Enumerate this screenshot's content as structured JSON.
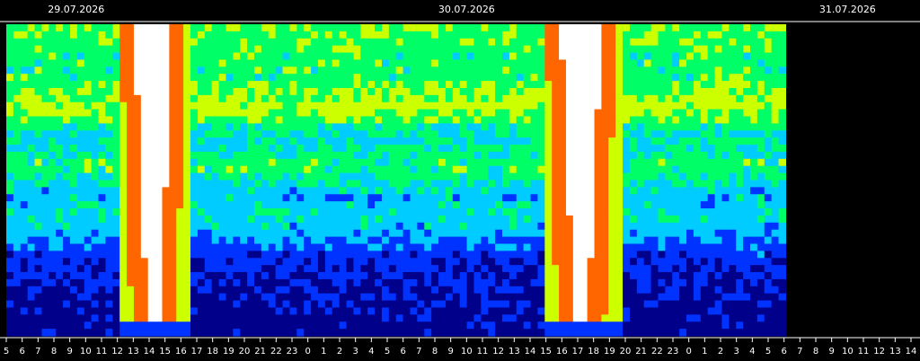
{
  "chart_data": {
    "type": "heatmap",
    "title": "",
    "xlabel": "",
    "ylabel": "",
    "dates": [
      "29.07.2026",
      "30.07.2026",
      "31.07.2026"
    ],
    "hour_ticks": [
      5,
      6,
      7,
      8,
      9,
      10,
      11,
      12,
      13,
      14,
      15,
      16,
      17,
      18,
      19,
      20,
      21,
      22,
      23,
      0,
      1,
      2,
      3,
      4,
      5,
      6,
      7,
      8,
      9,
      10,
      11,
      12,
      13,
      14,
      15,
      16,
      17,
      18,
      19,
      20,
      21,
      22,
      23,
      0,
      1,
      2,
      3,
      4,
      5,
      6,
      7,
      8,
      9,
      10,
      11,
      12,
      13,
      14
    ],
    "data_end_hour_index": 49.1,
    "intensity_bands": [
      {
        "center": 0.25,
        "strength": 0.55
      },
      {
        "center": 0.45,
        "strength": 0.5
      },
      {
        "center": 0.62,
        "strength": 0.4
      }
    ],
    "saturation_events": [
      {
        "start_hour_index": 6.8,
        "end_hour_index": 11.3
      },
      {
        "start_hour_index": 33.6,
        "end_hour_index": 38.4
      }
    ],
    "colormap": [
      "#00008b",
      "#0033ff",
      "#00ccff",
      "#00ff66",
      "#ccff00",
      "#ff6600",
      "#ffffff"
    ]
  }
}
